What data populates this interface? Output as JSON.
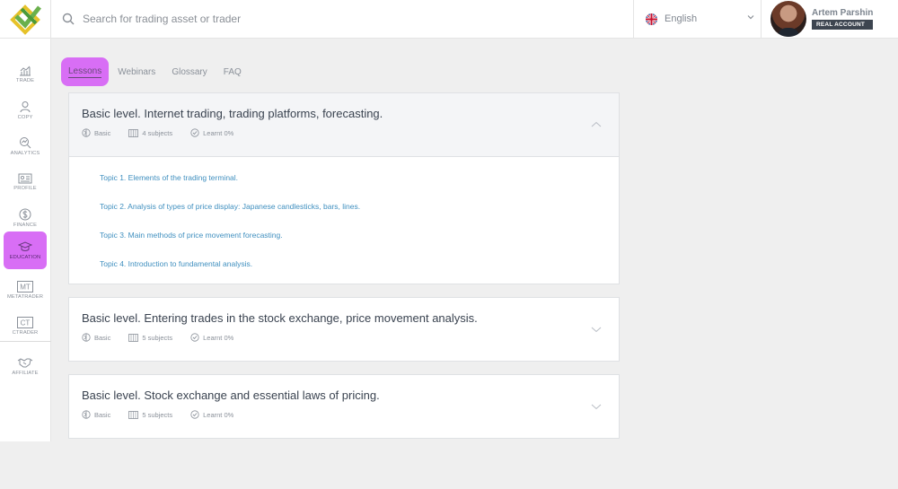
{
  "search": {
    "placeholder": "Search for trading asset or trader"
  },
  "language": {
    "selected": "English"
  },
  "user": {
    "name": "Artem Parshin",
    "account_badge": "REAL ACCOUNT"
  },
  "sidebar": {
    "items": [
      {
        "label": "TRADE",
        "icon": "chart-icon"
      },
      {
        "label": "COPY",
        "icon": "copy-trader-icon"
      },
      {
        "label": "ANALYTICS",
        "icon": "analytics-icon"
      },
      {
        "label": "PROFILE",
        "icon": "profile-card-icon"
      },
      {
        "label": "FINANCE",
        "icon": "dollar-icon"
      },
      {
        "label": "EDUCATION",
        "icon": "graduation-cap-icon",
        "active": true
      },
      {
        "label": "METATRADER",
        "icon": "mt-icon",
        "icon_text": "MT"
      },
      {
        "label": "CTRADER",
        "icon": "ct-icon",
        "icon_text": "CT"
      },
      {
        "label": "AFFILIATE",
        "icon": "handshake-icon"
      }
    ]
  },
  "tabs": [
    {
      "label": "Lessons",
      "active": true
    },
    {
      "label": "Webinars"
    },
    {
      "label": "Glossary"
    },
    {
      "label": "FAQ"
    }
  ],
  "courses": [
    {
      "title": "Basic level. Internet trading, trading platforms, forecasting.",
      "level": "Basic",
      "subjects": "4 subjects",
      "learnt": "Learnt 0%",
      "expanded": true,
      "topics": [
        "Topic 1. Elements of the trading terminal.",
        "Topic 2. Analysis of types of price display: Japanese candlesticks, bars, lines.",
        "Topic 3. Main methods of price movement forecasting.",
        "Topic 4. Introduction to fundamental analysis."
      ]
    },
    {
      "title": "Basic level. Entering trades in the stock exchange, price movement analysis.",
      "level": "Basic",
      "subjects": "5 subjects",
      "learnt": "Learnt 0%",
      "expanded": false
    },
    {
      "title": "Basic level. Stock exchange and essential laws of pricing.",
      "level": "Basic",
      "subjects": "5 subjects",
      "learnt": "Learnt 0%",
      "expanded": false
    }
  ],
  "colors": {
    "accent": "#d86ef5",
    "link": "#3f8fbf",
    "background": "#efefef",
    "logo_green": "#6ab04c",
    "logo_yellow": "#e6c229"
  }
}
